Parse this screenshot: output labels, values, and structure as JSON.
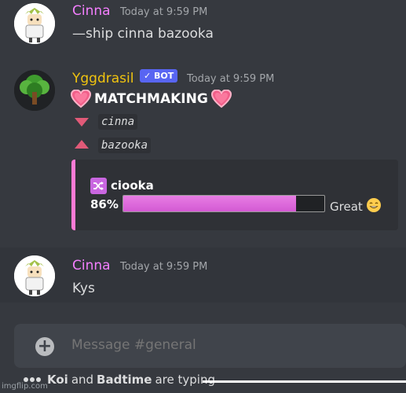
{
  "messages": [
    {
      "author": "Cinna",
      "author_color": "#f47fff",
      "timestamp": "Today at 9:59 PM",
      "text": "—ship cinna bazooka"
    },
    {
      "author": "Yggdrasil",
      "author_color": "#f1c40f",
      "bot_badge": "✓ BOT",
      "timestamp": "Today at 9:59 PM",
      "title": "MATCHMAKING",
      "down_name": "cinna",
      "up_name": "bazooka",
      "embed": {
        "accent_color": "#ff7bd5",
        "ship_name": "ciooka",
        "percent_label": "86%",
        "percent_value": 86,
        "rating": "Great"
      }
    },
    {
      "author": "Cinna",
      "author_color": "#f47fff",
      "timestamp": "Today at 9:59 PM",
      "text": "Kys"
    }
  ],
  "composer": {
    "placeholder": "Message #general"
  },
  "typing": {
    "user1": "Koi",
    "and": "and",
    "user2": "Badtime",
    "suffix": "are typing"
  },
  "watermark": "imgflip.com",
  "icons": {
    "add": "plus-circle-icon",
    "shuffle": "shuffle-icon",
    "heart": "heart-icon",
    "emoji": "grinning-emoji-icon"
  }
}
